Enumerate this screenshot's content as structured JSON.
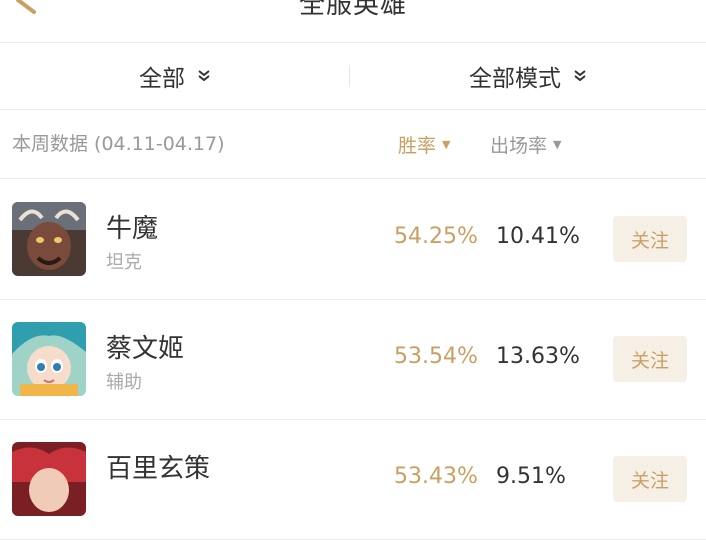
{
  "header": {
    "title": "全服英雄"
  },
  "filters": {
    "scope": "全部",
    "mode": "全部模式"
  },
  "sortbar": {
    "week_label": "本周数据 (04.11-04.17)",
    "win_label": "胜率",
    "pick_label": "出场率"
  },
  "heroes": [
    {
      "name": "牛魔",
      "role": "坦克",
      "win": "54.25%",
      "pick": "10.41%",
      "follow": "关注"
    },
    {
      "name": "蔡文姬",
      "role": "辅助",
      "win": "53.54%",
      "pick": "13.63%",
      "follow": "关注"
    },
    {
      "name": "百里玄策",
      "role": "",
      "win": "53.43%",
      "pick": "9.51%",
      "follow": "关注"
    }
  ],
  "colors": {
    "accent": "#c9a063",
    "follow_bg": "#f6efe6",
    "muted": "#999999"
  },
  "icons": {
    "back": "search-handle-icon",
    "dropdown": "chevron-down-icon",
    "sort": "triangle-down-icon"
  }
}
